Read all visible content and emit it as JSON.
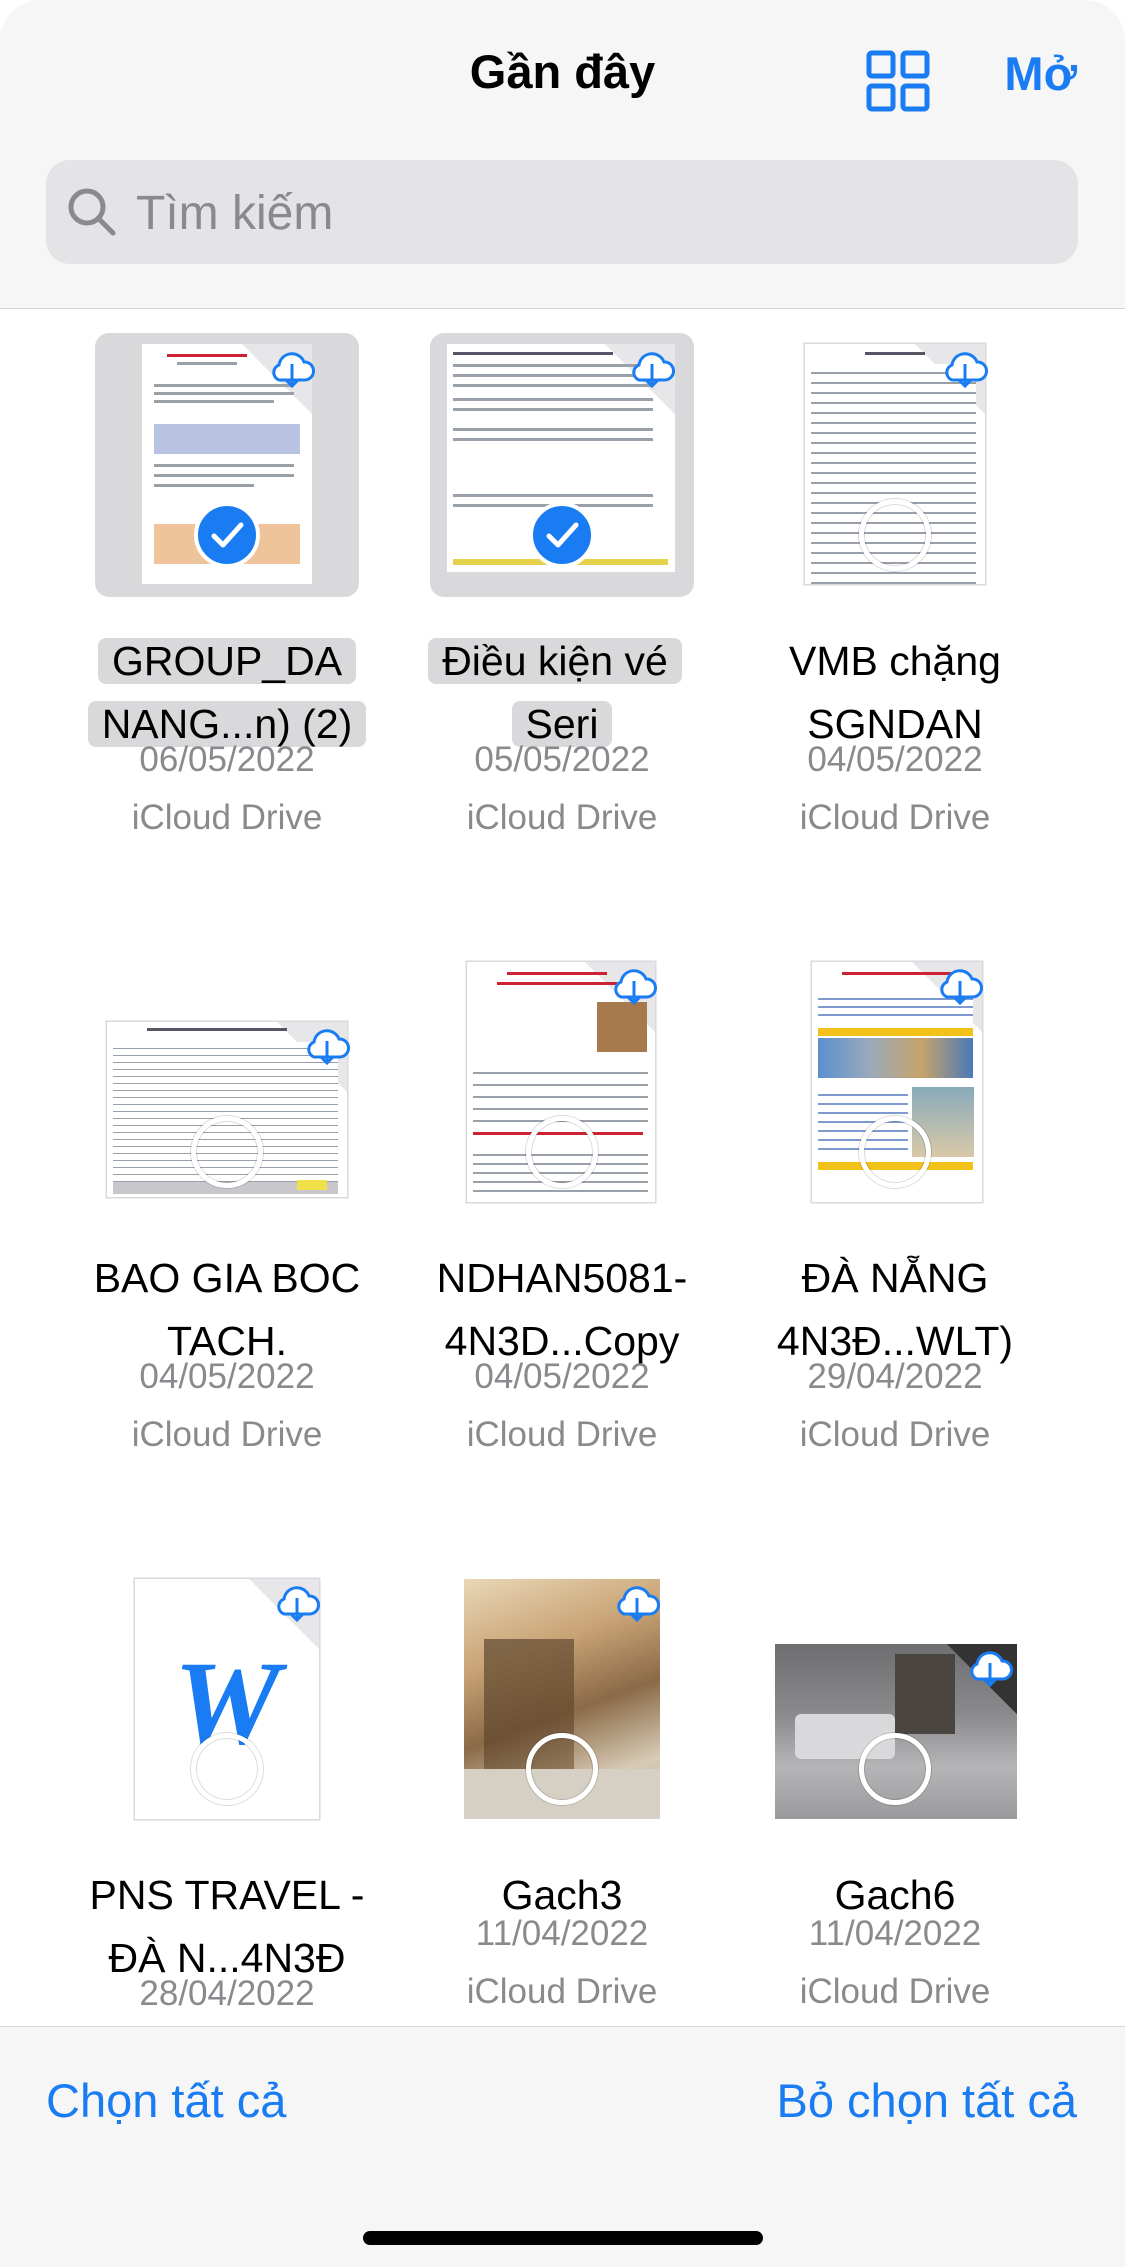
{
  "header": {
    "title": "Gần đây",
    "open_label": "Mở",
    "grid_icon": "grid-icon"
  },
  "search": {
    "placeholder": "Tìm kiếm",
    "value": ""
  },
  "colors": {
    "accent": "#1a7cf2",
    "secondary_text": "#8a8a8e",
    "selection": "#d9d9dc"
  },
  "files": [
    {
      "name": "GROUP_DA NANG...n) (2)",
      "date": "06/05/2022",
      "location": "iCloud Drive",
      "selected": true,
      "kind": "document"
    },
    {
      "name": "Điều kiện vé Seri",
      "date": "05/05/2022",
      "location": "iCloud Drive",
      "selected": true,
      "kind": "document"
    },
    {
      "name": "VMB chặng SGNDAN",
      "date": "04/05/2022",
      "location": "iCloud Drive",
      "selected": false,
      "kind": "document"
    },
    {
      "name": "BAO GIA BOC TACH.",
      "date": "04/05/2022",
      "location": "iCloud Drive",
      "selected": false,
      "kind": "spreadsheet"
    },
    {
      "name": "NDHAN5081- 4N3D...Copy",
      "date": "04/05/2022",
      "location": "iCloud Drive",
      "selected": false,
      "kind": "document"
    },
    {
      "name": "ĐÀ NẴNG 4N3Đ...WLT)",
      "date": "29/04/2022",
      "location": "iCloud Drive",
      "selected": false,
      "kind": "document"
    },
    {
      "name": "PNS TRAVEL - ĐÀ N...4N3Đ",
      "date": "28/04/2022",
      "location": "",
      "selected": false,
      "kind": "word"
    },
    {
      "name": "Gach3",
      "date": "11/04/2022",
      "location": "iCloud Drive",
      "selected": false,
      "kind": "photo"
    },
    {
      "name": "Gach6",
      "date": "11/04/2022",
      "location": "iCloud Drive",
      "selected": false,
      "kind": "photo"
    }
  ],
  "word_glyph": "W",
  "footer": {
    "select_all": "Chọn tất cả",
    "deselect_all": "Bỏ chọn tất cả"
  }
}
